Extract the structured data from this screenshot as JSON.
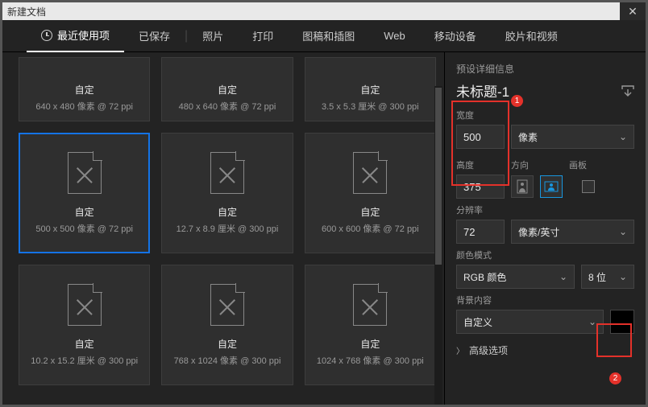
{
  "title": "新建文档",
  "tabs": {
    "recent": "最近使用项",
    "saved": "已保存",
    "photo": "照片",
    "print": "打印",
    "art": "图稿和插图",
    "web": "Web",
    "mobile": "移动设备",
    "film": "胶片和视频"
  },
  "presets": [
    {
      "name": "自定",
      "sub": "640 x 480 像素 @ 72 ppi"
    },
    {
      "name": "自定",
      "sub": "480 x 640 像素 @ 72 ppi"
    },
    {
      "name": "自定",
      "sub": "3.5 x 5.3 厘米 @ 300 ppi"
    },
    {
      "name": "自定",
      "sub": "500 x 500 像素 @ 72 ppi"
    },
    {
      "name": "自定",
      "sub": "12.7 x 8.9 厘米 @ 300 ppi"
    },
    {
      "name": "自定",
      "sub": "600 x 600 像素 @ 72 ppi"
    },
    {
      "name": "自定",
      "sub": "10.2 x 15.2 厘米 @ 300 ppi"
    },
    {
      "name": "自定",
      "sub": "768 x 1024 像素 @ 300 ppi"
    },
    {
      "name": "自定",
      "sub": "1024 x 768 像素 @ 300 ppi"
    }
  ],
  "panel": {
    "detailHdr": "预设详细信息",
    "docname": "未标题-1",
    "widthLbl": "宽度",
    "width": "500",
    "unit": "像素",
    "heightLbl": "高度",
    "height": "375",
    "orientLbl": "方向",
    "artboardLbl": "画板",
    "resLbl": "分辨率",
    "res": "72",
    "resUnit": "像素/英寸",
    "modeLbl": "颜色模式",
    "mode": "RGB 颜色",
    "bits": "8 位",
    "bgLbl": "背景内容",
    "bg": "自定义",
    "adv": "高级选项",
    "annot1": "1",
    "annot2": "2"
  }
}
